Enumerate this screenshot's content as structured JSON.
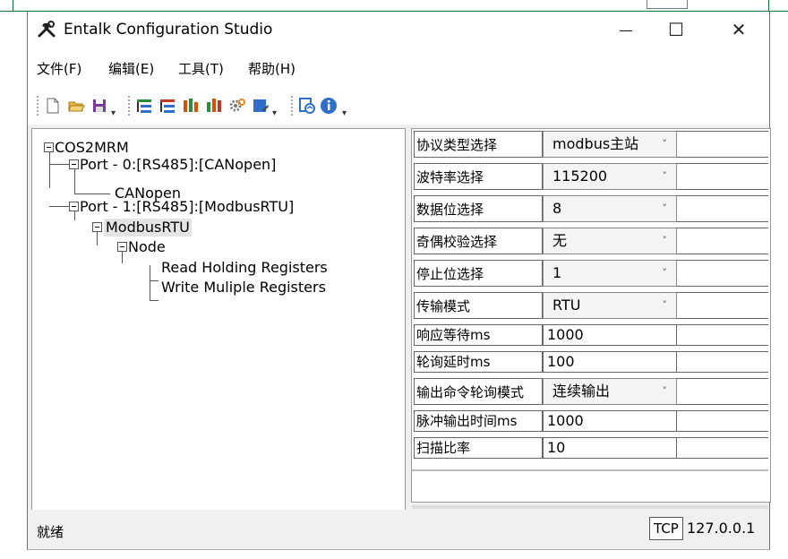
{
  "window": {
    "title": "Entalk Configuration Studio",
    "minimize_glyph": "—",
    "maximize_glyph": "☐",
    "close_glyph": "✕"
  },
  "menu": [
    "文件(F)",
    "编辑(E)",
    "工具(T)",
    "帮助(H)"
  ],
  "toolbar": {
    "icons": [
      "new-file-icon",
      "open-folder-icon",
      "save-icon",
      "tree-add-icon",
      "tree-remove-icon",
      "register-read-icon",
      "register-write-icon",
      "settings-gear-icon",
      "blue-note-icon",
      "connection-test-icon",
      "info-icon"
    ]
  },
  "tree": {
    "root": "COS2MRM",
    "port0": "Port - 0:[RS485]:[CANopen]",
    "canopen": "CANopen",
    "port1": "Port - 1:[RS485]:[ModbusRTU]",
    "modbus": "ModbusRTU",
    "node": "Node",
    "read": "Read Holding Registers",
    "write": "Write Muliple Registers"
  },
  "properties": [
    {
      "label": "协议类型选择",
      "value": "modbus主站",
      "dropdown": true
    },
    {
      "label": "波特率选择",
      "value": "115200",
      "dropdown": true
    },
    {
      "label": "数据位选择",
      "value": "8",
      "dropdown": true
    },
    {
      "label": "奇偶校验选择",
      "value": "无",
      "dropdown": true
    },
    {
      "label": "停止位选择",
      "value": "1",
      "dropdown": true
    },
    {
      "label": "传输模式",
      "value": "RTU",
      "dropdown": true
    },
    {
      "label": "响应等待ms",
      "value": "1000",
      "dropdown": false
    },
    {
      "label": "轮询延时ms",
      "value": "100",
      "dropdown": false
    },
    {
      "label": "输出命令轮询模式",
      "value": "连续输出",
      "dropdown": true
    },
    {
      "label": "脉冲输出时间ms",
      "value": "1000",
      "dropdown": false
    },
    {
      "label": "扫描比率",
      "value": "10",
      "dropdown": false
    }
  ],
  "dropdown_glyph": "˅",
  "status": {
    "text": "就绪",
    "protocol": "TCP",
    "ip": "127.0.0.1"
  },
  "colors": {
    "accent_green": "#0b7a3b",
    "toolbar_blue": "#2f6fc9"
  }
}
